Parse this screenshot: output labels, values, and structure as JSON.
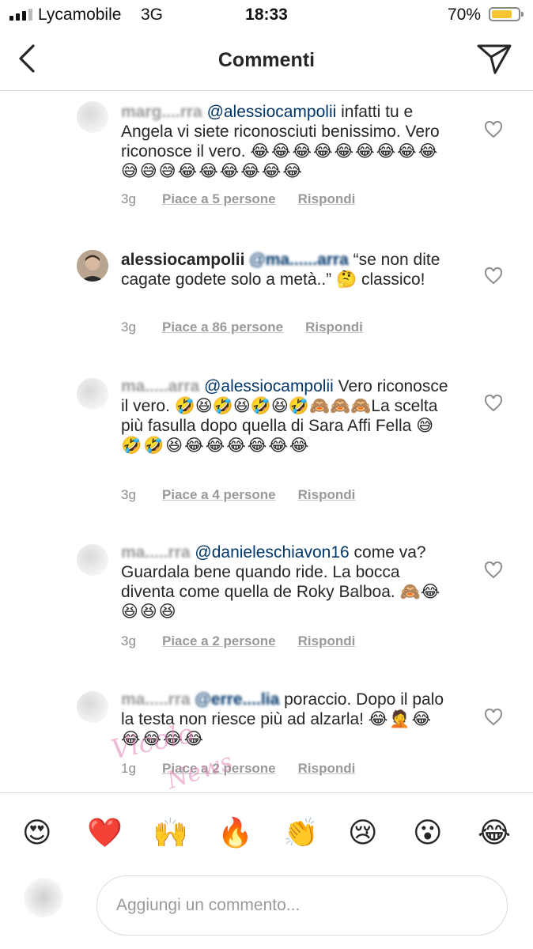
{
  "status_bar": {
    "carrier": "Lycamobile",
    "network": "3G",
    "time": "18:33",
    "battery_percent": "70%",
    "battery_level": 0.7,
    "battery_color": "#f7c531"
  },
  "header": {
    "title": "Commenti",
    "back_icon": "chevron-left-icon",
    "send_icon": "paper-plane-icon"
  },
  "comments": [
    {
      "username": "marg....rra",
      "mention": "@alessiocampolii",
      "text": " infatti tu e Angela vi siete riconosciuti benissimo. Vero riconosce il vero. ",
      "emoji": "😂😂😂😂😂😂😂😂😂😅😅😅😂😂😂😂😂😂",
      "time": "3g",
      "likes": "Piace a 5 persone",
      "reply": "Rispondi"
    },
    {
      "username": "alessiocampolii",
      "mention": "@ma......arra",
      "text": " “se non dite cagate godete solo a metà..” 🤔 classico!",
      "emoji": "",
      "time": "3g",
      "likes": "Piace a 86 persone",
      "reply": "Rispondi"
    },
    {
      "username": "ma.....arra",
      "mention": "@alessiocampolii",
      "text": " Vero riconosce il vero. 🤣😆🤣😆🤣😆🤣🙈🙈🙈La scelta più fasulla dopo quella di Sara Affi Fella ",
      "emoji": "😅🤣🤣😆😂😂😂😂😂😂",
      "time": "3g",
      "likes": "Piace a 4 persone",
      "reply": "Rispondi"
    },
    {
      "username": "ma.....rra",
      "mention": "@danieleschiavon16",
      "text": " come va? Guardala bene quando ride. La bocca diventa come quella de Roky Balboa. 🙈",
      "emoji": "😂😆😆😆",
      "time": "3g",
      "likes": "Piace a 2 persone",
      "reply": "Rispondi"
    },
    {
      "username": "ma.....rra",
      "mention": "@erre....lia",
      "text": " poraccio. Dopo il palo la testa non riesce più ad alzarla! ",
      "emoji": "😂🤦😂😂😂😂😂",
      "time": "1g",
      "likes": "Piace a 2 persone",
      "reply": "Rispondi"
    }
  ],
  "quick_emojis": [
    "😍",
    "❤️",
    "🙌",
    "🔥",
    "👏",
    "😢",
    "😮",
    "😂"
  ],
  "input": {
    "placeholder": "Aggiungi un commento..."
  },
  "watermark": {
    "line1": "Vicolo",
    "line2": "News"
  },
  "colors": {
    "text": "#262626",
    "secondary": "#8e8e8e",
    "mention": "#003569",
    "divider": "#dbdbdb"
  }
}
